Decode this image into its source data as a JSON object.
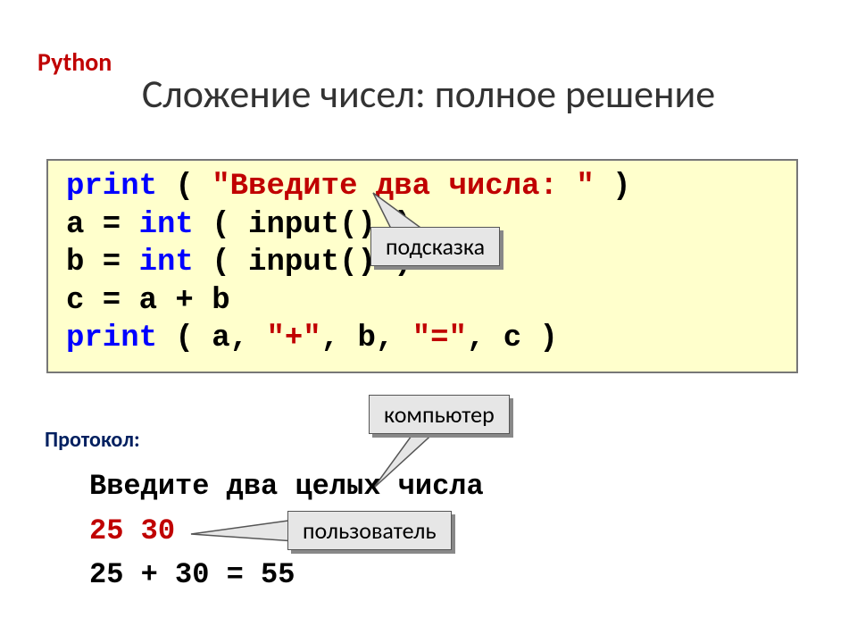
{
  "header": {
    "lang": "Python",
    "title": "Сложение чисел: полное решение"
  },
  "code": {
    "l1_kw": "print",
    "l1_paren1": " ( ",
    "l1_str": "\"Введите два числа: \"",
    "l1_paren2": " )",
    "l2_lhs": "a = ",
    "l2_kw": "int",
    "l2_rest": " ( input() )",
    "l3_lhs": "b = ",
    "l3_kw": "int",
    "l3_rest": " ( input() )",
    "l4": "c = a + b",
    "l5_kw": "print",
    "l5_p1": " ( a, ",
    "l5_s1": "\"+\"",
    "l5_p2": ", b, ",
    "l5_s2": "\"=\"",
    "l5_p3": ", c )"
  },
  "callouts": {
    "hint": "подсказка",
    "computer": "компьютер",
    "user": "пользователь"
  },
  "protocol": {
    "label": "Протокол:",
    "line1": "Введите два целых числа",
    "line2": "25 30",
    "line3": "25 + 30 = 55"
  }
}
